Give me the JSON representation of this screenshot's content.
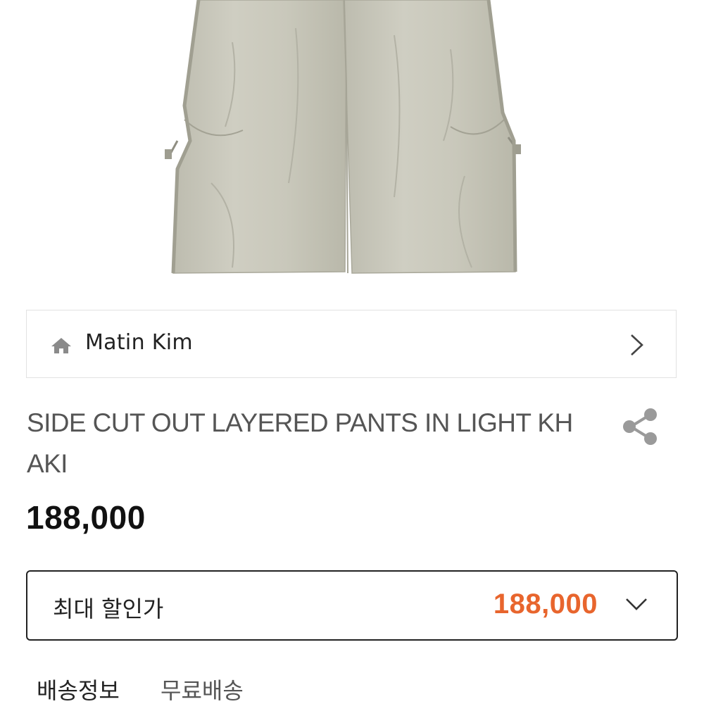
{
  "brand": {
    "name": "Matin Kim",
    "icon": "home-icon"
  },
  "product": {
    "title": "SIDE CUT OUT LAYERED PANTS IN LIGHT KHAKI",
    "price": "188,000",
    "image_color": "#c8c6b8"
  },
  "discount": {
    "label": "최대 할인가",
    "price": "188,000",
    "price_color": "#e8652d"
  },
  "shipping": {
    "label": "배송정보",
    "value": "무료배송"
  }
}
